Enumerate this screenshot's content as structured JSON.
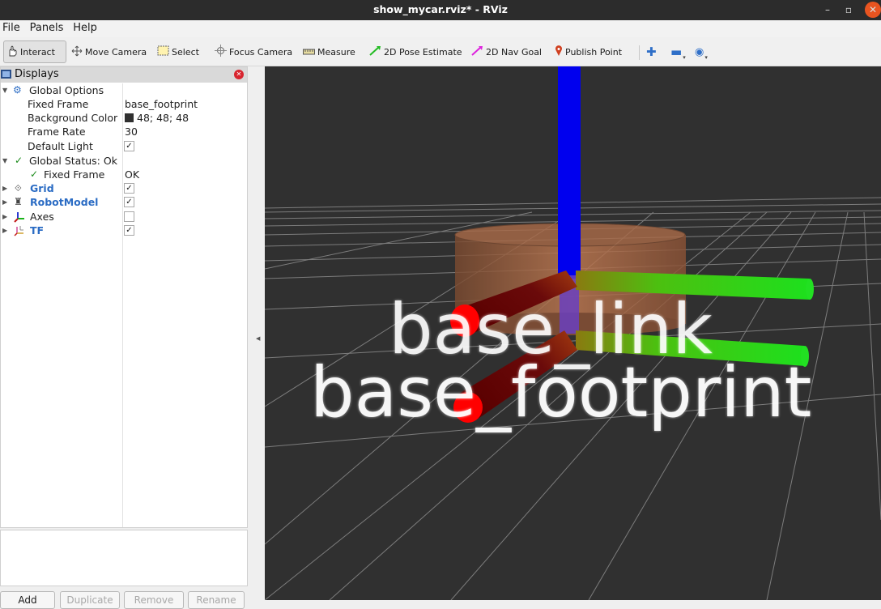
{
  "window": {
    "title": "show_mycar.rviz* - RViz",
    "controls": {
      "minimize": "–",
      "maximize": "▫",
      "close": "✕"
    }
  },
  "menu": {
    "items": [
      "File",
      "Panels",
      "Help"
    ]
  },
  "toolbar": {
    "interact": "Interact",
    "move_camera": "Move Camera",
    "select": "Select",
    "focus_camera": "Focus Camera",
    "measure": "Measure",
    "pose_estimate": "2D Pose Estimate",
    "nav_goal": "2D Nav Goal",
    "publish_point": "Publish Point",
    "plus_glyph": "✚",
    "minus_glyph": "▬",
    "eye_glyph": "◉"
  },
  "displays": {
    "header": "Displays",
    "close_glyph": "✕",
    "global_options": {
      "label": "Global Options",
      "fixed_frame_label": "Fixed Frame",
      "fixed_frame_value": "base_footprint",
      "background_color_label": "Background Color",
      "background_color_value": "48; 48; 48",
      "background_color_hex": "#303030",
      "frame_rate_label": "Frame Rate",
      "frame_rate_value": "30",
      "default_light_label": "Default Light",
      "default_light_checked": true
    },
    "global_status": {
      "label": "Global Status: Ok",
      "fixed_frame_label": "Fixed Frame",
      "fixed_frame_value": "OK"
    },
    "items": [
      {
        "label": "Grid",
        "icon": "grid-icon",
        "checked": true
      },
      {
        "label": "RobotModel",
        "icon": "robot-icon",
        "checked": true
      },
      {
        "label": "Axes",
        "icon": "axes-icon",
        "checked": false
      },
      {
        "label": "TF",
        "icon": "tf-icon",
        "checked": true
      }
    ],
    "check_glyph": "✓"
  },
  "buttons": {
    "add": "Add",
    "duplicate": "Duplicate",
    "remove": "Remove",
    "rename": "Rename"
  },
  "scene": {
    "frame_labels": [
      "base_link",
      "base_footprint"
    ],
    "colors": {
      "z_axis": "#0000ee",
      "y_axis": "#00dd00",
      "x_axis": "#880000",
      "body": "#c07850"
    }
  }
}
